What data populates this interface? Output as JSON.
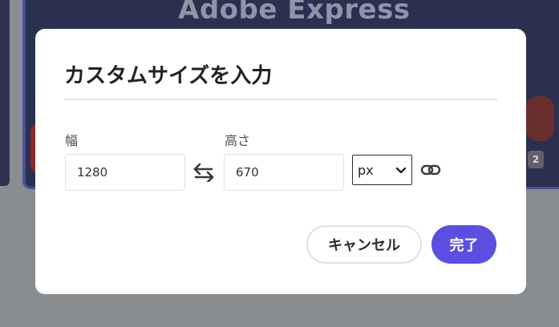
{
  "background": {
    "brand_text": "Adobe Express",
    "page_badge": "2"
  },
  "modal": {
    "title": "カスタムサイズを入力",
    "width_label": "幅",
    "width_value": "1280",
    "height_label": "高さ",
    "height_value": "670",
    "unit_selected": "px",
    "cancel_label": "キャンセル",
    "done_label": "完了"
  },
  "colors": {
    "primary": "#5a4fe0",
    "overlay": "#8a8d90"
  },
  "icons": {
    "swap": "swap-arrows-icon",
    "link": "link-icon",
    "chevron": "chevron-down-icon"
  }
}
